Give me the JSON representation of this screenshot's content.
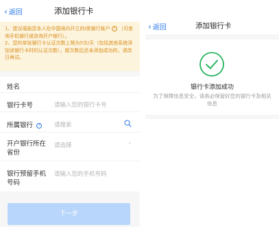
{
  "left": {
    "back_label": "返回",
    "title": "添加银行卡",
    "notice": {
      "line1_before": "1、建议填报您本人在中国境内开立的I类银行账户",
      "line1_after": "（可查询手机银行或咨询开户银行）。",
      "line2": "2、您的单张银行卡认证次数上限为5次/天（包括其他系统添加该银行卡时的认证次数），超次数后还未添加成功的，请改日再试。"
    },
    "fields": {
      "name_label": "姓名",
      "card_label": "银行卡号",
      "card_placeholder": "请输入您的银行卡号",
      "bank_label": "所属银行",
      "bank_placeholder": "请搜索",
      "province_label": "开户银行所在省份",
      "province_placeholder": "请选择",
      "phone_label": "银行预留手机号码",
      "phone_placeholder": "请输入您的手机号码"
    },
    "next_label": "下一步"
  },
  "right": {
    "back_label": "返回",
    "title": "添加银行卡",
    "success_title": "银行卡添加成功",
    "success_sub": "为了保障信息安全，请务必保管好您的银行卡及相关信息"
  },
  "colors": {
    "accent": "#2a77e8",
    "success": "#23b45a",
    "notice_bg": "#fdf4dd",
    "notice_text": "#d88c1c",
    "button_disabled": "#b8d5fb"
  }
}
